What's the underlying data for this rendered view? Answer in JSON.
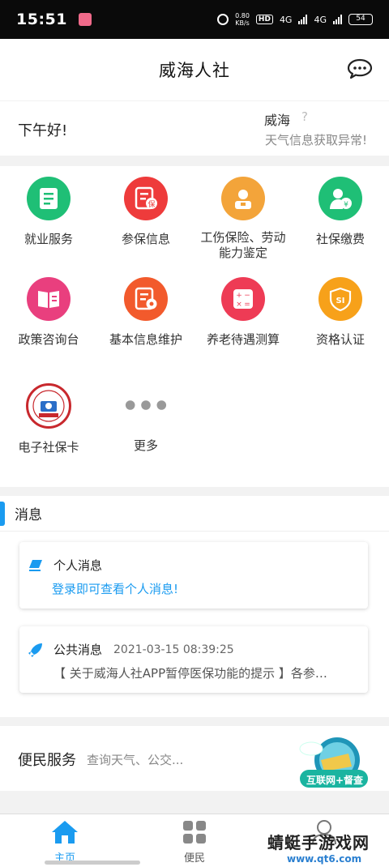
{
  "status_bar": {
    "time": "15:51",
    "speed_top": "0.80",
    "speed_bottom": "KB/s",
    "hd": "HD",
    "net1": "4G",
    "net2": "4G",
    "battery": "54"
  },
  "header": {
    "title": "威海人社",
    "message_icon": "chat-bubble-icon"
  },
  "greeting": {
    "hello": "下午好!",
    "city": "威海",
    "city_help": "?",
    "weather_status": "天气信息获取异常!"
  },
  "services": [
    {
      "label": "就业服务",
      "icon": "document-icon",
      "color": "#1fbf76"
    },
    {
      "label": "参保信息",
      "icon": "insurance-doc-icon",
      "color": "#ee3b3b"
    },
    {
      "label": "工伤保险、劳动能力鉴定",
      "icon": "worker-icon",
      "color": "#f3a43a"
    },
    {
      "label": "社保缴费",
      "icon": "user-payment-icon",
      "color": "#1fbf76"
    },
    {
      "label": "政策咨询台",
      "icon": "book-icon",
      "color": "#e93f7e"
    },
    {
      "label": "基本信息维护",
      "icon": "doc-settings-icon",
      "color": "#f25a2c"
    },
    {
      "label": "养老待遇测算",
      "icon": "calculator-icon",
      "color": "#ee3b55"
    },
    {
      "label": "资格认证",
      "icon": "shield-si-icon",
      "color": "#f7a11a"
    },
    {
      "label": "电子社保卡",
      "icon": "social-security-card-icon",
      "color": "#c8282d"
    },
    {
      "label": "更多",
      "icon": "more-dots-icon",
      "color": "#999999"
    }
  ],
  "messages": {
    "section_title": "消息",
    "personal": {
      "title": "个人消息",
      "text": "登录即可查看个人消息!",
      "accent": "#1a9bf0"
    },
    "public": {
      "title": "公共消息",
      "date": "2021-03-15 08:39:25",
      "text": "【 关于威海人社APP暂停医保功能的提示 】各参…"
    }
  },
  "convenience": {
    "title": "便民服务",
    "subtitle": "查询天气、公交...",
    "badge_text": "互联网+督查"
  },
  "tabbar": {
    "items": [
      {
        "label": "主页",
        "icon": "home-icon",
        "active": true
      },
      {
        "label": "便民",
        "icon": "grid-icon",
        "active": false
      },
      {
        "label": "",
        "icon": "person-icon",
        "active": false
      }
    ],
    "active_color": "#1a9bf0"
  },
  "watermark": {
    "line1": "蜻蜓手游戏网",
    "line2": "www.qt6.com"
  }
}
